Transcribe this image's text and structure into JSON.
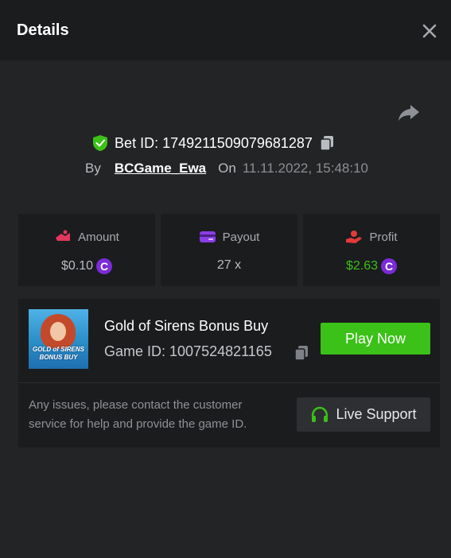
{
  "header": {
    "title": "Details"
  },
  "bet": {
    "id_label": "Bet ID: 1749211509079681287",
    "by_label": "By",
    "username": "BCGame_Ewa",
    "on_label": "On",
    "date": "11.11.2022, 15:48:10"
  },
  "stats": {
    "amount": {
      "label": "Amount",
      "value": "$0.10",
      "coin": "C"
    },
    "payout": {
      "label": "Payout",
      "value": "27 x"
    },
    "profit": {
      "label": "Profit",
      "value": "$2.63",
      "coin": "C"
    }
  },
  "game": {
    "thumbnail_line1": "GOLD of SIRENS",
    "thumbnail_line2": "BONUS BUY",
    "name": "Gold of Sirens Bonus Buy",
    "id_label": "Game ID: 1007524821165",
    "play_label": "Play Now",
    "note": "Any issues, please contact the customer service for help and provide the game ID.",
    "support_label": "Live Support"
  },
  "colors": {
    "green": "#3bc117",
    "profit": "#3bc117",
    "coin": "#7b2bd8"
  }
}
